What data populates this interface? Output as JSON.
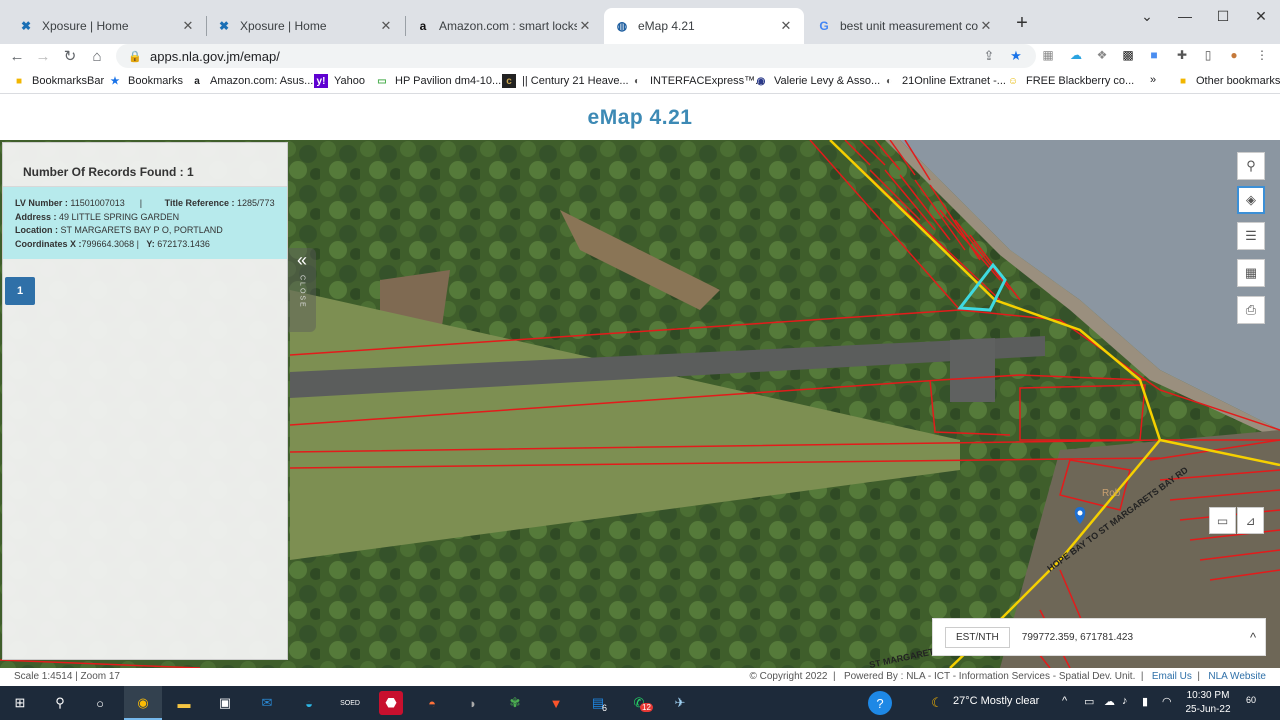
{
  "browser": {
    "tabs": [
      {
        "title": "Xposure | Home",
        "icon": "xposure-icon",
        "active": false
      },
      {
        "title": "Xposure | Home",
        "icon": "xposure-icon",
        "active": false
      },
      {
        "title": "Amazon.com : smart locks for fro",
        "icon": "amazon-icon",
        "active": false
      },
      {
        "title": "eMap 4.21",
        "icon": "emap-icon",
        "active": true
      },
      {
        "title": "best unit measurement converte",
        "icon": "google-icon",
        "active": false
      }
    ],
    "url": "apps.nla.gov.jm/emap/",
    "bookmarks": [
      "BookmarksBar",
      "Bookmarks",
      "Amazon.com: Asus...",
      "Yahoo",
      "HP Pavilion dm4-10...",
      "|| Century 21 Heave...",
      "INTERFACExpress™...",
      "Valerie Levy & Asso...",
      "21Online Extranet -...",
      "FREE Blackberry co..."
    ],
    "other_bookmarks": "Other bookmarks",
    "more_chevron": "»"
  },
  "page": {
    "title": "eMap 4.21"
  },
  "results": {
    "header": "Number Of Records Found : 1",
    "record": {
      "lv_label": "LV Number :",
      "lv_value": "11501007013",
      "sep": "|",
      "title_label": "Title Reference :",
      "title_value": "1285/773",
      "address_label": "Address :",
      "address_value": "49 LITTLE SPRING GARDEN",
      "location_label": "Location :",
      "location_value": "ST MARGARETS BAY P O, PORTLAND",
      "coords_label": "Coordinates X :",
      "coords_x": "799664.3068",
      "coords_y_label": "Y:",
      "coords_y": "672173.1436"
    },
    "page_number": "1",
    "collapse_glyph": "«",
    "collapse_label": "CLOSE"
  },
  "map": {
    "road_label": "HOPE BAY TO ST MARGARETS BAY RD",
    "road_label_2": "ST MARGARETS BA",
    "place_label": "Rob",
    "tools": [
      "search-icon",
      "layers-icon",
      "list-icon",
      "qr-icon",
      "print-icon"
    ],
    "measure_tools": [
      "ruler-icon",
      "measure-area-icon"
    ]
  },
  "coords_panel": {
    "button": "EST/NTH",
    "value": "799772.359, 671781.423",
    "chevron": "^"
  },
  "status": {
    "scale": "Scale 1:4514 | Zoom 17",
    "copyright": "© Copyright 2022",
    "powered": "Powered By : NLA - ICT - Information Services - Spatial Dev. Unit.",
    "email": "Email Us",
    "website": "NLA Website"
  },
  "taskbar": {
    "weather": "27°C  Mostly clear",
    "time": "10:30 PM",
    "date": "25-Jun-22",
    "outlook_badge": "6",
    "whatsapp_badge": "12",
    "notif_badge": "60"
  },
  "colors": {
    "accent": "#3d8ab5",
    "record_bg": "#b7eaec",
    "parcel_line": "#e31b1b",
    "highlight_parcel": "#3fd9e0",
    "road": "#f5d000"
  }
}
